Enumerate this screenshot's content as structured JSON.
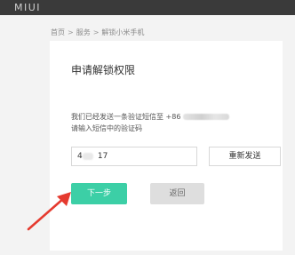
{
  "header": {
    "brand": "MIUI"
  },
  "breadcrumb": {
    "items": [
      "首页",
      "服务",
      "解锁小米手机"
    ],
    "separator": ">"
  },
  "card": {
    "title": "申请解锁权限",
    "desc_line1": "我们已经发送一条验证短信至 +86",
    "desc_line2": "请输入短信中的验证码",
    "code_value": "4      17",
    "resend_label": "重新发送",
    "next_label": "下一步",
    "back_label": "返回"
  },
  "colors": {
    "accent": "#3ccfa6",
    "arrow": "#e53a2f",
    "topbar": "#3a3a3a"
  }
}
